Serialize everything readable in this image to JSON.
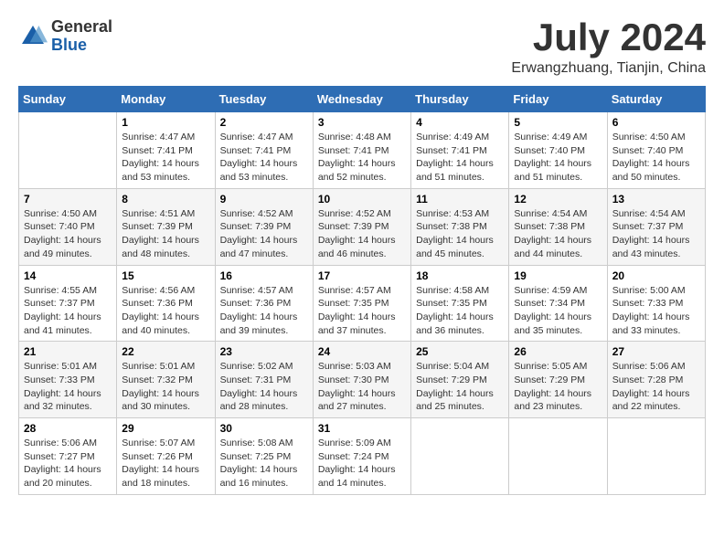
{
  "logo": {
    "general": "General",
    "blue": "Blue"
  },
  "title": "July 2024",
  "subtitle": "Erwangzhuang, Tianjin, China",
  "days_header": [
    "Sunday",
    "Monday",
    "Tuesday",
    "Wednesday",
    "Thursday",
    "Friday",
    "Saturday"
  ],
  "weeks": [
    [
      {
        "day": "",
        "info": ""
      },
      {
        "day": "1",
        "info": "Sunrise: 4:47 AM\nSunset: 7:41 PM\nDaylight: 14 hours and 53 minutes."
      },
      {
        "day": "2",
        "info": "Sunrise: 4:47 AM\nSunset: 7:41 PM\nDaylight: 14 hours and 53 minutes."
      },
      {
        "day": "3",
        "info": "Sunrise: 4:48 AM\nSunset: 7:41 PM\nDaylight: 14 hours and 52 minutes."
      },
      {
        "day": "4",
        "info": "Sunrise: 4:49 AM\nSunset: 7:41 PM\nDaylight: 14 hours and 51 minutes."
      },
      {
        "day": "5",
        "info": "Sunrise: 4:49 AM\nSunset: 7:40 PM\nDaylight: 14 hours and 51 minutes."
      },
      {
        "day": "6",
        "info": "Sunrise: 4:50 AM\nSunset: 7:40 PM\nDaylight: 14 hours and 50 minutes."
      }
    ],
    [
      {
        "day": "7",
        "info": "Sunrise: 4:50 AM\nSunset: 7:40 PM\nDaylight: 14 hours and 49 minutes."
      },
      {
        "day": "8",
        "info": "Sunrise: 4:51 AM\nSunset: 7:39 PM\nDaylight: 14 hours and 48 minutes."
      },
      {
        "day": "9",
        "info": "Sunrise: 4:52 AM\nSunset: 7:39 PM\nDaylight: 14 hours and 47 minutes."
      },
      {
        "day": "10",
        "info": "Sunrise: 4:52 AM\nSunset: 7:39 PM\nDaylight: 14 hours and 46 minutes."
      },
      {
        "day": "11",
        "info": "Sunrise: 4:53 AM\nSunset: 7:38 PM\nDaylight: 14 hours and 45 minutes."
      },
      {
        "day": "12",
        "info": "Sunrise: 4:54 AM\nSunset: 7:38 PM\nDaylight: 14 hours and 44 minutes."
      },
      {
        "day": "13",
        "info": "Sunrise: 4:54 AM\nSunset: 7:37 PM\nDaylight: 14 hours and 43 minutes."
      }
    ],
    [
      {
        "day": "14",
        "info": "Sunrise: 4:55 AM\nSunset: 7:37 PM\nDaylight: 14 hours and 41 minutes."
      },
      {
        "day": "15",
        "info": "Sunrise: 4:56 AM\nSunset: 7:36 PM\nDaylight: 14 hours and 40 minutes."
      },
      {
        "day": "16",
        "info": "Sunrise: 4:57 AM\nSunset: 7:36 PM\nDaylight: 14 hours and 39 minutes."
      },
      {
        "day": "17",
        "info": "Sunrise: 4:57 AM\nSunset: 7:35 PM\nDaylight: 14 hours and 37 minutes."
      },
      {
        "day": "18",
        "info": "Sunrise: 4:58 AM\nSunset: 7:35 PM\nDaylight: 14 hours and 36 minutes."
      },
      {
        "day": "19",
        "info": "Sunrise: 4:59 AM\nSunset: 7:34 PM\nDaylight: 14 hours and 35 minutes."
      },
      {
        "day": "20",
        "info": "Sunrise: 5:00 AM\nSunset: 7:33 PM\nDaylight: 14 hours and 33 minutes."
      }
    ],
    [
      {
        "day": "21",
        "info": "Sunrise: 5:01 AM\nSunset: 7:33 PM\nDaylight: 14 hours and 32 minutes."
      },
      {
        "day": "22",
        "info": "Sunrise: 5:01 AM\nSunset: 7:32 PM\nDaylight: 14 hours and 30 minutes."
      },
      {
        "day": "23",
        "info": "Sunrise: 5:02 AM\nSunset: 7:31 PM\nDaylight: 14 hours and 28 minutes."
      },
      {
        "day": "24",
        "info": "Sunrise: 5:03 AM\nSunset: 7:30 PM\nDaylight: 14 hours and 27 minutes."
      },
      {
        "day": "25",
        "info": "Sunrise: 5:04 AM\nSunset: 7:29 PM\nDaylight: 14 hours and 25 minutes."
      },
      {
        "day": "26",
        "info": "Sunrise: 5:05 AM\nSunset: 7:29 PM\nDaylight: 14 hours and 23 minutes."
      },
      {
        "day": "27",
        "info": "Sunrise: 5:06 AM\nSunset: 7:28 PM\nDaylight: 14 hours and 22 minutes."
      }
    ],
    [
      {
        "day": "28",
        "info": "Sunrise: 5:06 AM\nSunset: 7:27 PM\nDaylight: 14 hours and 20 minutes."
      },
      {
        "day": "29",
        "info": "Sunrise: 5:07 AM\nSunset: 7:26 PM\nDaylight: 14 hours and 18 minutes."
      },
      {
        "day": "30",
        "info": "Sunrise: 5:08 AM\nSunset: 7:25 PM\nDaylight: 14 hours and 16 minutes."
      },
      {
        "day": "31",
        "info": "Sunrise: 5:09 AM\nSunset: 7:24 PM\nDaylight: 14 hours and 14 minutes."
      },
      {
        "day": "",
        "info": ""
      },
      {
        "day": "",
        "info": ""
      },
      {
        "day": "",
        "info": ""
      }
    ]
  ]
}
